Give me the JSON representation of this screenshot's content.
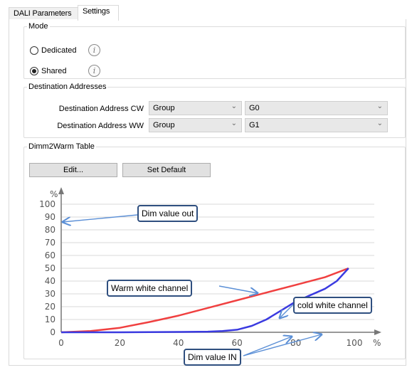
{
  "tabs": [
    {
      "label": "DALI Parameters"
    },
    {
      "label": "Settings"
    }
  ],
  "mode": {
    "legend": "Mode",
    "options": [
      {
        "label": "Dedicated",
        "selected": false
      },
      {
        "label": "Shared",
        "selected": true
      }
    ],
    "info_glyph": "i"
  },
  "destination": {
    "legend": "Destination Addresses",
    "rows": [
      {
        "label": "Destination Address CW",
        "type": "Group",
        "address": "G0"
      },
      {
        "label": "Destination Address WW",
        "type": "Group",
        "address": "G1"
      }
    ]
  },
  "dimm_table": {
    "legend": "Dimm2Warm Table",
    "edit_label": "Edit...",
    "default_label": "Set Default"
  },
  "chart_data": {
    "type": "line",
    "xlabel": "%",
    "ylabel": "%",
    "xlim": [
      0,
      100
    ],
    "ylim": [
      0,
      100
    ],
    "x_ticks": [
      "0",
      "20",
      "40",
      "60",
      "80",
      "100"
    ],
    "y_ticks": [
      "0",
      "10",
      "20",
      "30",
      "40",
      "50",
      "60",
      "70",
      "80",
      "90",
      "100"
    ],
    "grid": true,
    "series": [
      {
        "color": "#f04040",
        "points": [
          [
            0,
            0
          ],
          [
            10,
            1
          ],
          [
            20,
            3.5
          ],
          [
            30,
            8
          ],
          [
            40,
            13
          ],
          [
            50,
            19
          ],
          [
            60,
            25
          ],
          [
            70,
            31
          ],
          [
            80,
            37
          ],
          [
            90,
            43
          ],
          [
            98,
            50
          ]
        ]
      },
      {
        "color": "#3a3ae0",
        "points": [
          [
            0,
            0
          ],
          [
            20,
            0
          ],
          [
            40,
            0.3
          ],
          [
            50,
            0.5
          ],
          [
            55,
            1
          ],
          [
            60,
            2
          ],
          [
            65,
            5
          ],
          [
            70,
            10
          ],
          [
            75,
            17
          ],
          [
            80,
            24
          ],
          [
            85,
            29
          ],
          [
            90,
            34
          ],
          [
            94,
            40
          ],
          [
            98,
            50
          ]
        ]
      }
    ]
  },
  "annotations": {
    "dim_out": "Dim value out",
    "warm": "Warm white channel",
    "cold": "cold white channel",
    "dim_in": "Dim value IN"
  },
  "colors": {
    "warm_line": "#f04040",
    "cold_line": "#3a3ae0",
    "callout_border": "#2f4f7f",
    "arrow": "#5b8fd6"
  },
  "icons": {
    "info": "info-icon",
    "dropdown": "chevron-down-icon"
  }
}
